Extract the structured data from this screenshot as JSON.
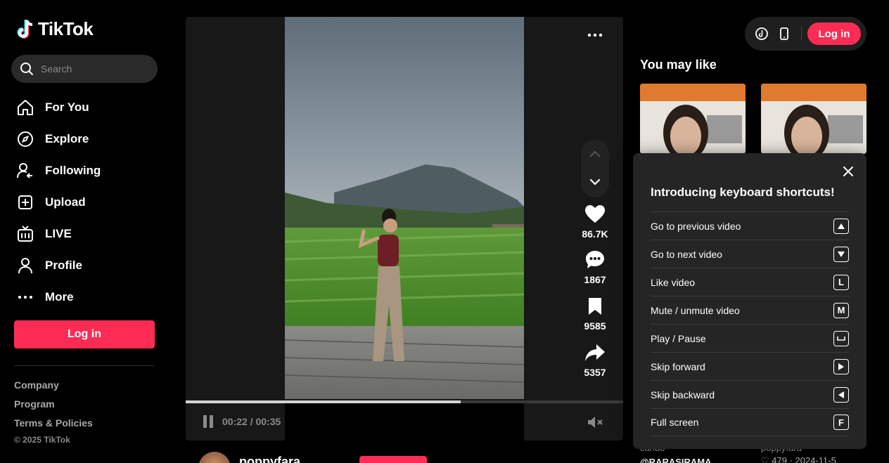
{
  "brand": {
    "name": "TikTok",
    "accent": "#fe2c55"
  },
  "search": {
    "placeholder": "Search"
  },
  "sidebar": {
    "items": [
      {
        "label": "For You",
        "icon": "home-icon"
      },
      {
        "label": "Explore",
        "icon": "compass-icon"
      },
      {
        "label": "Following",
        "icon": "following-icon"
      },
      {
        "label": "Upload",
        "icon": "upload-icon"
      },
      {
        "label": "LIVE",
        "icon": "live-icon"
      },
      {
        "label": "Profile",
        "icon": "profile-icon"
      },
      {
        "label": "More",
        "icon": "more-icon"
      }
    ],
    "login_label": "Log in",
    "footer_links": [
      "Company",
      "Program",
      "Terms & Policies"
    ],
    "copyright": "© 2025 TikTok"
  },
  "video": {
    "current_time": "00:22",
    "duration": "00:35",
    "time_text": "00:22 / 00:35",
    "progress_fraction": 0.6286,
    "likes": "86.7K",
    "comments": "1867",
    "saves": "9585",
    "shares": "5357"
  },
  "author": {
    "name": "poppyfara"
  },
  "topbar": {
    "login_label": "Log in"
  },
  "recommendations": {
    "title": "You may like",
    "items": [
      {
        "meta": "@RARASIRAMA"
      },
      {
        "meta": "poppyfara"
      }
    ],
    "left_caption": "cando",
    "right_stats": "♡ 479 · 2024-11-5"
  },
  "shortcuts": {
    "title": "Introducing keyboard shortcuts!",
    "items": [
      {
        "label": "Go to previous video",
        "key": "▲"
      },
      {
        "label": "Go to next video",
        "key": "▼"
      },
      {
        "label": "Like video",
        "key": "L"
      },
      {
        "label": "Mute / unmute video",
        "key": "M"
      },
      {
        "label": "Play / Pause",
        "key": "␣"
      },
      {
        "label": "Skip forward",
        "key": "▶"
      },
      {
        "label": "Skip backward",
        "key": "◀"
      },
      {
        "label": "Full screen",
        "key": "F"
      }
    ]
  }
}
